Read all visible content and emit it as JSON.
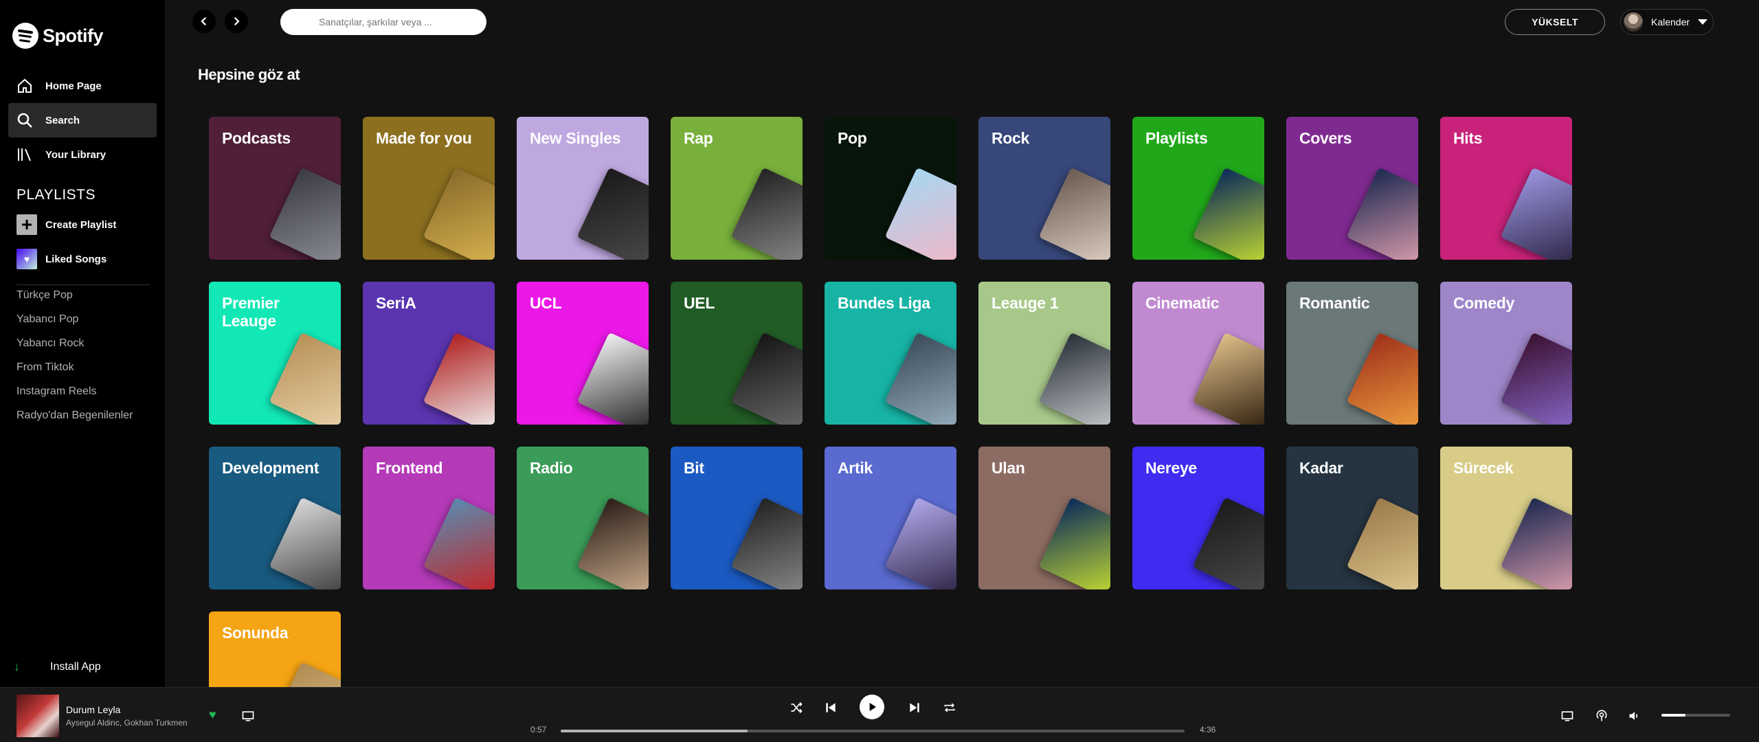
{
  "brand": "Spotify",
  "nav": [
    {
      "label": "Home Page",
      "icon": "home-icon",
      "active": false
    },
    {
      "label": "Search",
      "icon": "search-icon",
      "active": true
    },
    {
      "label": "Your Library",
      "icon": "library-icon",
      "active": false
    }
  ],
  "playlists_heading": "PLAYLISTS",
  "create_playlist": "Create Playlist",
  "liked_songs": "Liked Songs",
  "playlists": [
    "Türkçe Pop",
    "Yabancı Pop",
    "Yabancı Rock",
    "From Tiktok",
    "Instagram Reels",
    "Radyo'dan Begenilenler"
  ],
  "install_app": "Install App",
  "search_placeholder": "Sanatçılar, şarkılar veya ...",
  "upgrade": "YÜKSELT",
  "user_name": "Kalender",
  "page_title": "Hepsine göz at",
  "categories": [
    {
      "title": "Podcasts",
      "color": "#511f38",
      "cover": [
        "#3a3a44",
        "#8d8f96"
      ]
    },
    {
      "title": "Made for you",
      "color": "#8c6f1f",
      "cover": [
        "#8a6a2a",
        "#d8b450"
      ]
    },
    {
      "title": "New Singles",
      "color": "#bfa8e0",
      "cover": [
        "#1a1a1a",
        "#4a4a4a"
      ]
    },
    {
      "title": "Rap",
      "color": "#79b03c",
      "cover": [
        "#222222",
        "#8a8a8a"
      ]
    },
    {
      "title": "Pop",
      "color": "#07150a",
      "cover": [
        "#a8d6f0",
        "#f2b6c8"
      ]
    },
    {
      "title": "Rock",
      "color": "#37477a",
      "cover": [
        "#6a5a50",
        "#e0d2c6"
      ]
    },
    {
      "title": "Playlists",
      "color": "#20a81a",
      "cover": [
        "#0a2a5a",
        "#c8e030"
      ]
    },
    {
      "title": "Covers",
      "color": "#7f2a91",
      "cover": [
        "#1c2850",
        "#e0a0b0"
      ]
    },
    {
      "title": "Hits",
      "color": "#c8227a",
      "cover": [
        "#9a96e0",
        "#2a2040"
      ]
    },
    {
      "title": "Premier Leauge",
      "color": "#12e8b6",
      "cover": [
        "#b89058",
        "#e8d2a8"
      ]
    },
    {
      "title": "SeriA",
      "color": "#5b34b0",
      "cover": [
        "#b02020",
        "#f2f2f2"
      ]
    },
    {
      "title": "UCL",
      "color": "#ec18e8",
      "cover": [
        "#f2f2f2",
        "#202020"
      ]
    },
    {
      "title": "UEL",
      "color": "#215c25",
      "cover": [
        "#151515",
        "#6a6a6a"
      ]
    },
    {
      "title": "Bundes Liga",
      "color": "#17b4a6",
      "cover": [
        "#3a4a58",
        "#9ab0c0"
      ]
    },
    {
      "title": "Leauge 1",
      "color": "#a8c88a",
      "cover": [
        "#2a3038",
        "#c8ccd0"
      ]
    },
    {
      "title": "Cinematic",
      "color": "#c18ad0",
      "cover": [
        "#e0c08a",
        "#2a1a0a"
      ]
    },
    {
      "title": "Romantic",
      "color": "#6b7878",
      "cover": [
        "#a0301a",
        "#f0a040"
      ]
    },
    {
      "title": "Comedy",
      "color": "#9f86c8",
      "cover": [
        "#3a1030",
        "#8a6acc"
      ]
    },
    {
      "title": "Development",
      "color": "#185a80",
      "cover": [
        "#d8d8d8",
        "#3a3a3a"
      ]
    },
    {
      "title": "Frontend",
      "color": "#b43ab8",
      "cover": [
        "#5a8ab0",
        "#c82020"
      ]
    },
    {
      "title": "Radio",
      "color": "#3a9c58",
      "cover": [
        "#2a1e18",
        "#d0b090"
      ]
    },
    {
      "title": "Bit",
      "color": "#1a5ac2",
      "cover": [
        "#222222",
        "#8a8a8a"
      ]
    },
    {
      "title": "Artik",
      "color": "#5a6ad0",
      "cover": [
        "#b0a8ea",
        "#2a2040"
      ]
    },
    {
      "title": "Ulan",
      "color": "#8c6c62",
      "cover": [
        "#0a2a5a",
        "#c8e030"
      ]
    },
    {
      "title": "Nereye",
      "color": "#3f2cf0",
      "cover": [
        "#1a1a1a",
        "#4a4a4a"
      ]
    },
    {
      "title": "Kadar",
      "color": "#253440",
      "cover": [
        "#9a7a4a",
        "#e0c890"
      ]
    },
    {
      "title": "Sürecek",
      "color": "#d8cc88",
      "cover": [
        "#1c2850",
        "#e0a0b0"
      ]
    },
    {
      "title": "Sonunda",
      "color": "#f5a414",
      "cover": [
        "#b08a50",
        "#e8d09a"
      ]
    }
  ],
  "player": {
    "title": "Durum Leyla",
    "artist": "Aysegul Aldinc, Gokhan Turkmen",
    "elapsed": "0:57",
    "duration": "4:36",
    "progress": 0.3,
    "volume": 0.35
  }
}
